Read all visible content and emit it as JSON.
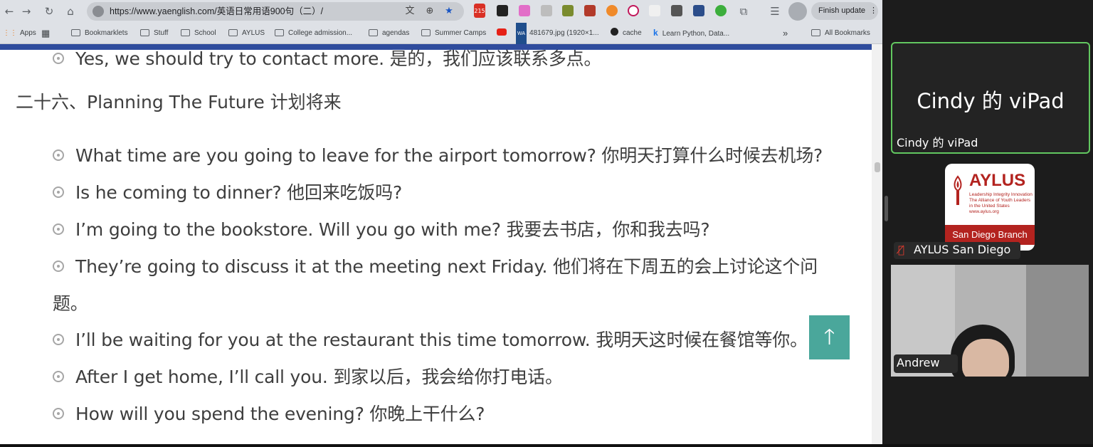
{
  "browser": {
    "url": "https://www.yaenglish.com/英语日常用语900句（二）/",
    "finish_update": "Finish update",
    "extension_badge": "215",
    "bookmarks": [
      {
        "label": "Apps",
        "icon": "apps-grid-icon"
      },
      {
        "label": "",
        "icon": "tab-groups-icon"
      },
      {
        "label": "Bookmarklets",
        "icon": "folder-icon"
      },
      {
        "label": "Stuff",
        "icon": "folder-icon"
      },
      {
        "label": "School",
        "icon": "folder-icon"
      },
      {
        "label": "AYLUS",
        "icon": "folder-icon"
      },
      {
        "label": "College admission...",
        "icon": "folder-icon"
      },
      {
        "label": "agendas",
        "icon": "folder-icon"
      },
      {
        "label": "Summer Camps",
        "icon": "folder-icon"
      },
      {
        "label": "",
        "icon": "youtube-icon"
      },
      {
        "label": "481679.jpg (1920×1...",
        "icon": "image-icon"
      },
      {
        "label": "cache",
        "icon": "github-icon"
      },
      {
        "label": "Learn Python, Data...",
        "icon": "site-k-icon"
      },
      {
        "label": "»",
        "icon": "overflow-chevron-icon"
      },
      {
        "label": "All Bookmarks",
        "icon": "folder-icon"
      }
    ]
  },
  "page": {
    "items_top": [
      {
        "text": "Yes, we should try to contact more. 是的，我们应该联系多点。"
      }
    ],
    "section_heading": "二十六、Planning The Future 计划将来",
    "items": [
      {
        "text": "What time are you going to leave for the airport tomorrow? 你明天打算什么时候去机场?"
      },
      {
        "text": "Is he coming to dinner? 他回来吃饭吗?"
      },
      {
        "text": "I’m going to the bookstore. Will you go with me? 我要去书店，你和我去吗?"
      },
      {
        "text": "They’re going to discuss it at the meeting next Friday. 他们将在下周五的会上讨论这个问",
        "continuation": "题。"
      },
      {
        "text": "I’ll be waiting for you at the restaurant this time tomorrow. 我明天这时候在餐馆等你。"
      },
      {
        "text": "After I get home, I’ll call you. 到家以后，我会给你打电话。"
      },
      {
        "text": "How will you spend the evening? 你晚上干什么?"
      }
    ],
    "back_to_top_icon": "arrow-up-icon"
  },
  "meeting": {
    "participants": [
      {
        "name": "Cindy 的 viPad",
        "display": "Cindy 的 viPad",
        "active_speaker": true
      },
      {
        "name": "AYLUS San Diego",
        "muted": true,
        "logo": {
          "word": "AYLUS",
          "tagline": "Leadership Integrity Innovation The Alliance of Youth Leaders in the United States www.aylus.org",
          "branch": "San Diego Branch"
        }
      },
      {
        "name": "Andrew",
        "video": true
      }
    ],
    "colors": {
      "active_border": "#62c760",
      "aylus_red": "#b3231f",
      "back_to_top": "#4aa79b",
      "page_bar": "#2f4c9d"
    }
  }
}
